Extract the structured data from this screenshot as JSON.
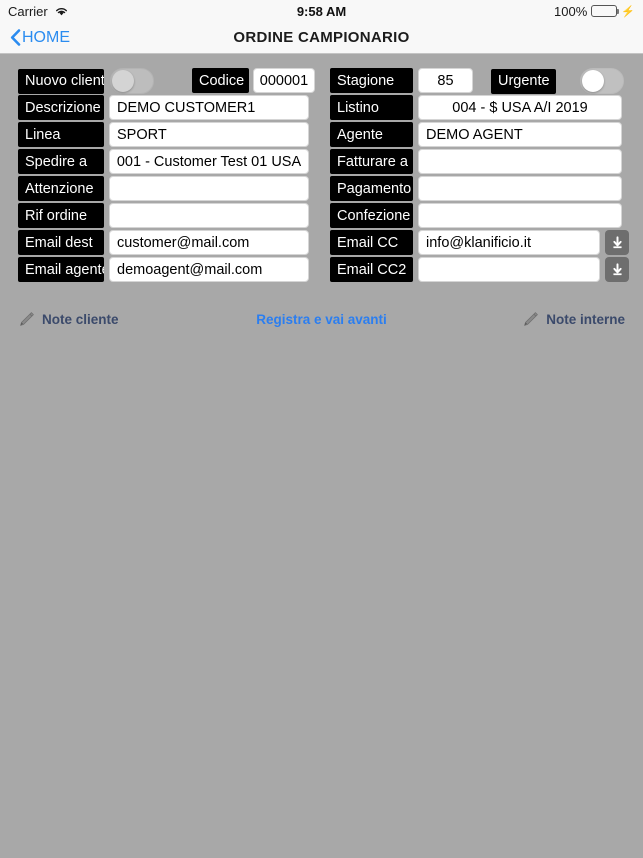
{
  "status_bar": {
    "carrier": "Carrier",
    "wifi_icon": "wifi-icon",
    "time": "9:58 AM",
    "battery_percent": "100%",
    "battery_level": 100,
    "charging_icon": "bolt-icon"
  },
  "nav_bar": {
    "back_icon": "chevron-left-icon",
    "back_label": "HOME",
    "title": "ORDINE CAMPIONARIO",
    "accent_color": "#2b8cf0"
  },
  "form": {
    "left_column": [
      {
        "label": "Nuovo cliente",
        "type": "toggle",
        "value": "off"
      },
      {
        "label": "Descrizione",
        "type": "text",
        "value": "DEMO CUSTOMER1",
        "align": "left"
      },
      {
        "label": "Linea",
        "type": "text",
        "value": "SPORT",
        "align": "left"
      },
      {
        "label": "Spedire a",
        "type": "text",
        "value": "001 - Customer Test 01  USA",
        "align": "center"
      },
      {
        "label": "Attenzione",
        "type": "text",
        "value": "",
        "align": "left"
      },
      {
        "label": "Rif ordine",
        "type": "text",
        "value": "",
        "align": "left"
      },
      {
        "label": "Email dest",
        "type": "text",
        "value": "customer@mail.com",
        "align": "left"
      },
      {
        "label": "Email agente",
        "type": "text",
        "value": "demoagent@mail.com",
        "align": "left"
      }
    ],
    "codice": {
      "label": "Codice",
      "value": "000001"
    },
    "right_column": [
      {
        "label": "Stagione",
        "type": "text",
        "value": "85",
        "align": "center"
      },
      {
        "label": "Urgente",
        "type": "toggle",
        "value": "off"
      },
      {
        "label": "Listino",
        "type": "text",
        "value": "004 - $ USA A/I 2019",
        "align": "center"
      },
      {
        "label": "Agente",
        "type": "text",
        "value": "DEMO AGENT",
        "align": "left"
      },
      {
        "label": "Fatturare a",
        "type": "text",
        "value": "",
        "align": "left"
      },
      {
        "label": "Pagamento",
        "type": "text",
        "value": "",
        "align": "left"
      },
      {
        "label": "Confezione",
        "type": "text",
        "value": "",
        "align": "left"
      },
      {
        "label": "Email CC",
        "type": "text",
        "value": "info@klanificio.it",
        "align": "left",
        "has_download": true
      },
      {
        "label": "Email CC2",
        "type": "text",
        "value": "",
        "align": "left",
        "has_download": true
      }
    ]
  },
  "actions": {
    "note_cliente": {
      "label": "Note cliente",
      "icon": "pencil-icon"
    },
    "registra": {
      "label": "Registra e vai avanti"
    },
    "note_interne": {
      "label": "Note interne",
      "icon": "pencil-icon"
    }
  },
  "colors": {
    "background": "#a8a8a8",
    "label_bg": "#000000",
    "field_bg": "#ffffff",
    "link": "#2b7ef0",
    "note_text": "#3b4a6b",
    "battery_green": "#41d754"
  }
}
